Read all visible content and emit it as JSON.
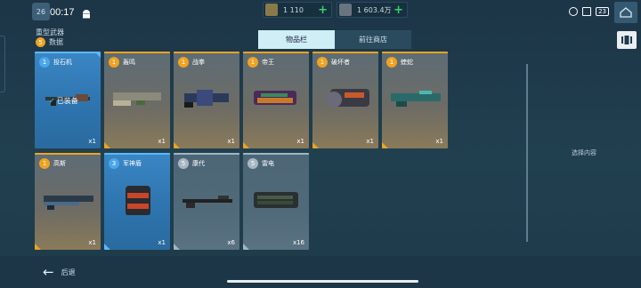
{
  "status_bar": {
    "level": "26",
    "time": "00:17",
    "battery": "23"
  },
  "currency": [
    {
      "value": "1 110"
    },
    {
      "value": "1 603.4万"
    }
  ],
  "header": {
    "category_title": "重型武器",
    "count_badge": "5",
    "count_label": "数据"
  },
  "tabs": [
    {
      "label": "物品栏",
      "active": true
    },
    {
      "label": "前往商店",
      "active": false
    }
  ],
  "items": [
    {
      "tier": "1",
      "name": "投石机",
      "qty": "x1",
      "rarity": "blue",
      "equipped": true
    },
    {
      "tier": "1",
      "name": "轰鸣",
      "qty": "x1",
      "rarity": "gold"
    },
    {
      "tier": "1",
      "name": "战拳",
      "qty": "x1",
      "rarity": "gold"
    },
    {
      "tier": "1",
      "name": "帝王",
      "qty": "x1",
      "rarity": "gold"
    },
    {
      "tier": "1",
      "name": "破坏者",
      "qty": "x1",
      "rarity": "gold"
    },
    {
      "tier": "1",
      "name": "蝰蛇",
      "qty": "x1",
      "rarity": "gold"
    },
    {
      "tier": "1",
      "name": "高斯",
      "qty": "x1",
      "rarity": "gold"
    },
    {
      "tier": "3",
      "name": "军神盾",
      "qty": "x1",
      "rarity": "blue"
    },
    {
      "tier": "5",
      "name": "康代",
      "qty": "x6",
      "rarity": "gray"
    },
    {
      "tier": "5",
      "name": "雷电",
      "qty": "x16",
      "rarity": "gray"
    }
  ],
  "equipped_label": "已装备",
  "right_panel": {
    "hint": "选择内容"
  },
  "footer": {
    "back_label": "后退"
  }
}
